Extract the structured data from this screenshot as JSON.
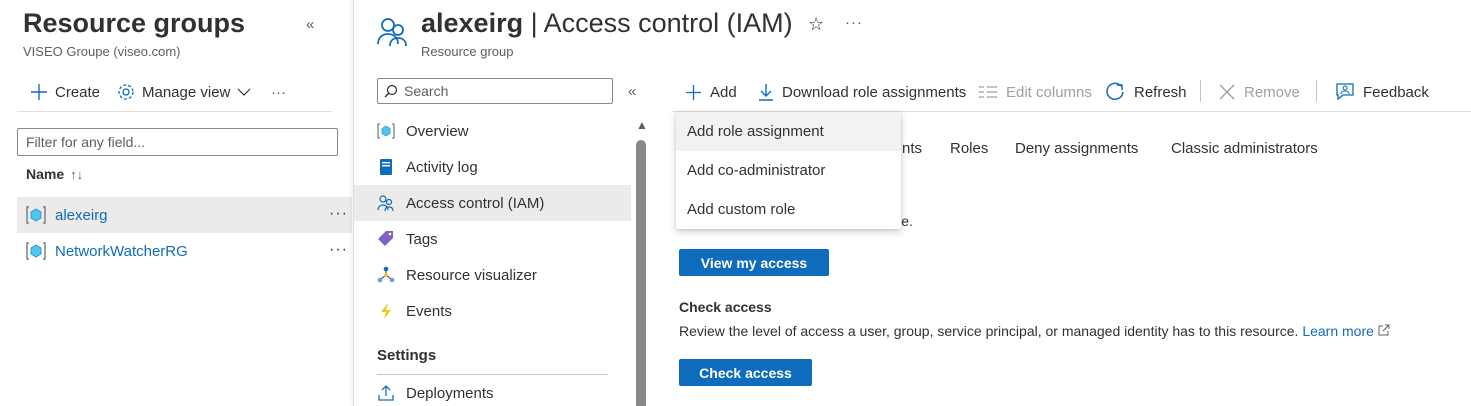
{
  "left": {
    "title": "Resource groups",
    "subtitle": "VISEO Groupe (viseo.com)",
    "collapse": "«",
    "toolbar": {
      "create": "Create",
      "manage_view": "Manage view",
      "more": "···"
    },
    "filter_placeholder": "Filter for any field...",
    "name_header": "Name",
    "sort_glyph": "↑↓",
    "rows": [
      {
        "name": "alexeirg",
        "more": "···"
      },
      {
        "name": "NetworkWatcherRG",
        "more": "···"
      }
    ]
  },
  "header": {
    "resource": "alexeirg",
    "page": " | Access control (IAM)",
    "subtitle": "Resource group",
    "star": "☆",
    "more": "···"
  },
  "nav": {
    "search_placeholder": "Search",
    "collapse": "«",
    "items": [
      {
        "label": "Overview"
      },
      {
        "label": "Activity log"
      },
      {
        "label": "Access control (IAM)"
      },
      {
        "label": "Tags"
      },
      {
        "label": "Resource visualizer"
      },
      {
        "label": "Events"
      }
    ],
    "settings_heading": "Settings",
    "settings_items": [
      {
        "label": "Deployments"
      }
    ]
  },
  "commands": {
    "add": "Add",
    "download": "Download role assignments",
    "edit_columns": "Edit columns",
    "refresh": "Refresh",
    "remove": "Remove",
    "feedback": "Feedback"
  },
  "tabs": {
    "partial": "nts",
    "roles": "Roles",
    "deny": "Deny assignments",
    "classic": "Classic administrators"
  },
  "add_menu": {
    "items": [
      {
        "label": "Add role assignment"
      },
      {
        "label": "Add co-administrator"
      },
      {
        "label": "Add custom role"
      }
    ]
  },
  "my_access": {
    "fragment": "ource.",
    "button": "View my access"
  },
  "check_access": {
    "heading": "Check access",
    "description": "Review the level of access a user, group, service principal, or managed identity has to this resource.",
    "learn_more": "Learn more",
    "button": "Check access"
  },
  "colors": {
    "accent": "#0f6cbd",
    "selected_bg": "#edebe9",
    "disabled": "#a19f9d"
  }
}
